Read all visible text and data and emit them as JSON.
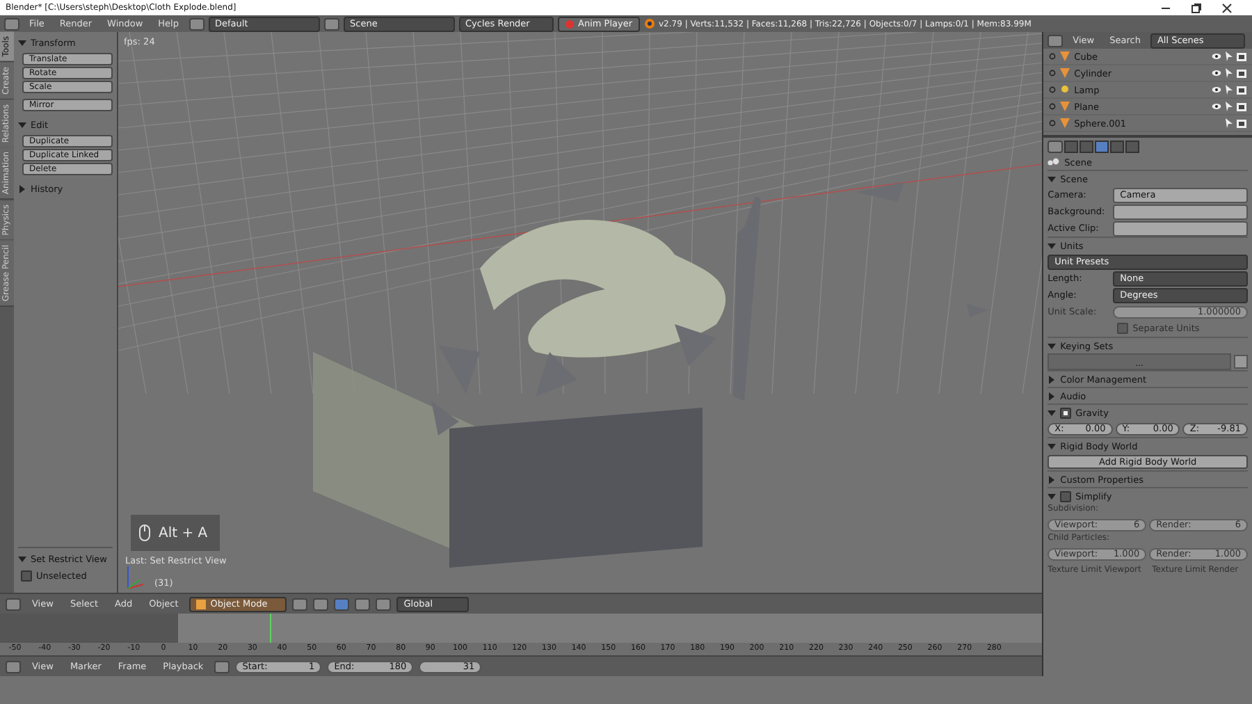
{
  "title_bar": {
    "title": "Blender* [C:\\Users\\steph\\Desktop\\Cloth Explode.blend]"
  },
  "menu_bar": {
    "menus": [
      "File",
      "Render",
      "Window",
      "Help"
    ],
    "layout": "Default",
    "scene": "Scene",
    "engine": "Cycles Render",
    "anim_player": "Anim Player",
    "stats": "v2.79 | Verts:11,532 | Faces:11,268 | Tris:22,726 | Objects:0/7 | Lamps:0/1 | Mem:83.99M"
  },
  "tool_shelf": {
    "tabs": [
      {
        "label": "Tools",
        "selected": true
      },
      {
        "label": "Create",
        "selected": false
      },
      {
        "label": "Relations",
        "selected": false
      },
      {
        "label": "Animation",
        "selected": false
      },
      {
        "label": "Physics",
        "selected": false
      },
      {
        "label": "Grease Pencil",
        "selected": false
      }
    ],
    "panels": [
      {
        "title": "Transform",
        "expanded": true,
        "groups": [
          [
            "Translate",
            "Rotate",
            "Scale"
          ],
          [
            "Mirror"
          ]
        ]
      },
      {
        "title": "Edit",
        "expanded": true,
        "groups": [
          [
            "Duplicate",
            "Duplicate Linked",
            "Delete"
          ]
        ]
      },
      {
        "title": "History",
        "expanded": false
      }
    ],
    "operator_panel": {
      "title": "Set Restrict View",
      "expanded": true,
      "option": {
        "label": "Unselected",
        "checked": false
      }
    }
  },
  "viewport": {
    "fps": "fps: 24",
    "key_overlay": "Alt + A",
    "last_operator": "Last: Set Restrict View",
    "frame": "(31)"
  },
  "viewport_header": {
    "menus": [
      "View",
      "Select",
      "Add",
      "Object"
    ],
    "mode": "Object Mode",
    "orientation": "Global"
  },
  "timeline": {
    "ruler": [
      "-50",
      "-40",
      "-30",
      "-20",
      "-10",
      "0",
      "10",
      "20",
      "30",
      "40",
      "50",
      "60",
      "70",
      "80",
      "90",
      "100",
      "110",
      "120",
      "130",
      "140",
      "150",
      "160",
      "170",
      "180",
      "190",
      "200",
      "210",
      "220",
      "230",
      "240",
      "250",
      "260",
      "270",
      "280"
    ]
  },
  "timeline_header": {
    "menus": [
      "View",
      "Marker",
      "Frame",
      "Playback"
    ],
    "start": {
      "label": "Start:",
      "value": "1"
    },
    "end": {
      "label": "End:",
      "value": "180"
    },
    "current": "31"
  },
  "outliner": {
    "menus": [
      "View",
      "Search"
    ],
    "filter": "All Scenes",
    "items": [
      {
        "name": "Cube",
        "kind": "mesh",
        "visible": true
      },
      {
        "name": "Cylinder",
        "kind": "mesh",
        "visible": true
      },
      {
        "name": "Lamp",
        "kind": "lamp",
        "visible": true
      },
      {
        "name": "Plane",
        "kind": "mesh",
        "visible": true
      },
      {
        "name": "Sphere.001",
        "kind": "mesh",
        "visible": false
      }
    ]
  },
  "properties": {
    "tabs": [
      {
        "selected": false
      },
      {
        "selected": false
      },
      {
        "selected": true
      },
      {
        "selected": false
      },
      {
        "selected": false
      }
    ],
    "breadcrumb": "Scene",
    "panels": [
      {
        "title": "Scene",
        "kind": "fields",
        "expanded": true,
        "rows": [
          {
            "label": "Camera:",
            "value": "Camera"
          },
          {
            "label": "Background:",
            "value": ""
          },
          {
            "label": "Active Clip:",
            "value": ""
          }
        ]
      },
      {
        "title": "Units",
        "kind": "units",
        "expanded": true,
        "presets": "Unit Presets",
        "rows": [
          {
            "label": "Length:",
            "value": "None"
          },
          {
            "label": "Angle:",
            "value": "Degrees"
          }
        ],
        "scale": {
          "label": "Unit Scale:",
          "value": "1.000000"
        },
        "separate": {
          "label": "Separate Units",
          "checked": false,
          "disabled": true
        }
      },
      {
        "title": "Keying Sets",
        "kind": "list",
        "expanded": true,
        "list_text": "..."
      },
      {
        "title": "Color Management",
        "expanded": false
      },
      {
        "title": "Audio",
        "expanded": false
      },
      {
        "title": "Gravity",
        "kind": "vector",
        "expanded": true,
        "checked": true,
        "values": [
          {
            "label": "X:",
            "value": "0.00"
          },
          {
            "label": "Y:",
            "value": "0.00"
          },
          {
            "label": "Z:",
            "value": "-9.81"
          }
        ]
      },
      {
        "title": "Rigid Body World",
        "kind": "button",
        "expanded": true,
        "button": "Add Rigid Body World"
      },
      {
        "title": "Custom Properties",
        "expanded": false
      },
      {
        "title": "Simplify",
        "kind": "simplify",
        "expanded": true,
        "checked": false,
        "groups": [
          {
            "label": "Subdivision:",
            "pairs": [
              {
                "label": "Viewport:",
                "value": "6"
              },
              {
                "label": "Render:",
                "value": "6"
              }
            ]
          },
          {
            "label": "Child Particles:",
            "pairs": [
              {
                "label": "Viewport:",
                "value": "1.000"
              },
              {
                "label": "Render:",
                "value": "1.000"
              }
            ]
          }
        ],
        "footer": [
          "Texture Limit Viewport",
          "Texture Limit Render"
        ]
      }
    ]
  }
}
